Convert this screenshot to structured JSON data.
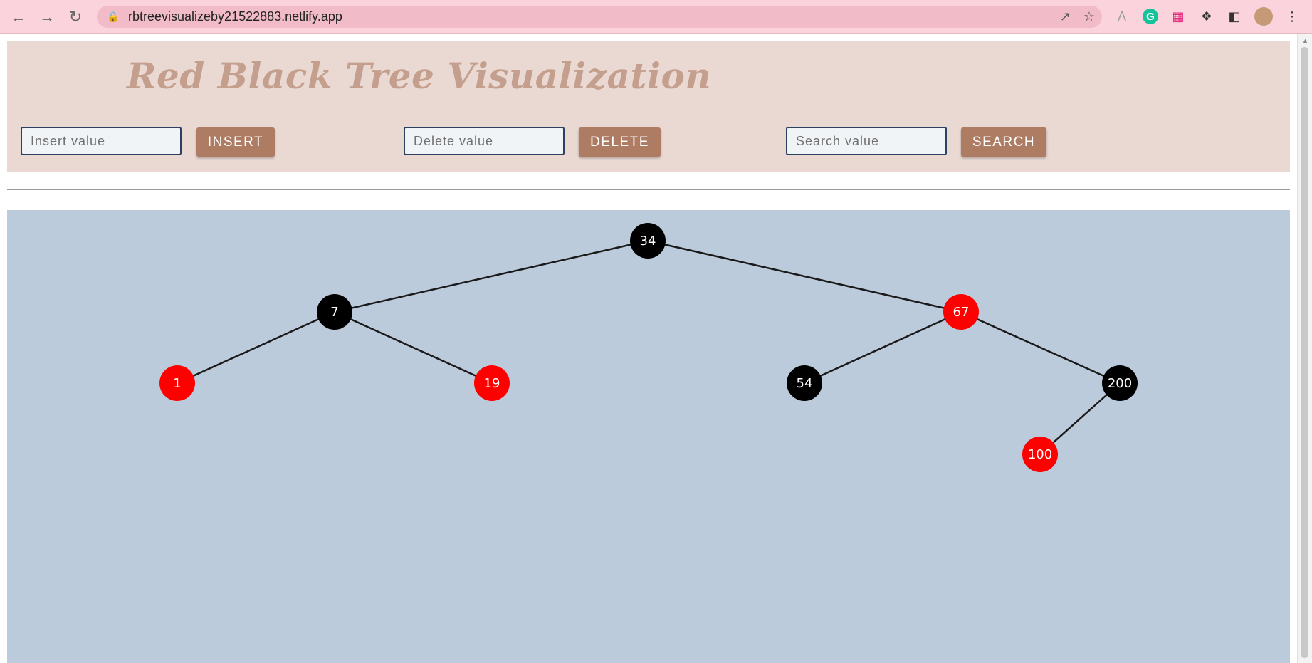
{
  "browser": {
    "url": "rbtreevisualizeby21522883.netlify.app",
    "icons": [
      "back-icon",
      "forward-icon",
      "reload-icon",
      "lock-icon",
      "share-icon",
      "star-icon",
      "extension-icon",
      "grammarly-icon",
      "figma-icon",
      "puzzle-icon",
      "sidepanel-icon",
      "avatar",
      "menu-icon"
    ]
  },
  "app": {
    "title": "Red Black Tree Visualization",
    "insert": {
      "placeholder": "Insert value",
      "button": "INSERT"
    },
    "delete": {
      "placeholder": "Delete value",
      "button": "DELETE"
    },
    "search": {
      "placeholder": "Search value",
      "button": "SEARCH"
    },
    "colors": {
      "header_bg": "#ead9d3",
      "title": "#c59f8d",
      "button": "#ae7b63",
      "canvas_bg": "#bccbdb",
      "red_node": "#ff0000",
      "black_node": "#000000"
    }
  },
  "tree": {
    "nodes": [
      {
        "id": "34",
        "value": "34",
        "color": "black",
        "depth": 0
      },
      {
        "id": "7",
        "value": "7",
        "color": "black",
        "depth": 1
      },
      {
        "id": "67",
        "value": "67",
        "color": "red",
        "depth": 1
      },
      {
        "id": "1",
        "value": "1",
        "color": "red",
        "depth": 2
      },
      {
        "id": "19",
        "value": "19",
        "color": "red",
        "depth": 2
      },
      {
        "id": "54",
        "value": "54",
        "color": "black",
        "depth": 2
      },
      {
        "id": "200",
        "value": "200",
        "color": "black",
        "depth": 2
      },
      {
        "id": "100",
        "value": "100",
        "color": "red",
        "depth": 3
      }
    ],
    "edges": [
      [
        "34",
        "7"
      ],
      [
        "34",
        "67"
      ],
      [
        "7",
        "1"
      ],
      [
        "7",
        "19"
      ],
      [
        "67",
        "54"
      ],
      [
        "67",
        "200"
      ],
      [
        "200",
        "100"
      ]
    ]
  }
}
